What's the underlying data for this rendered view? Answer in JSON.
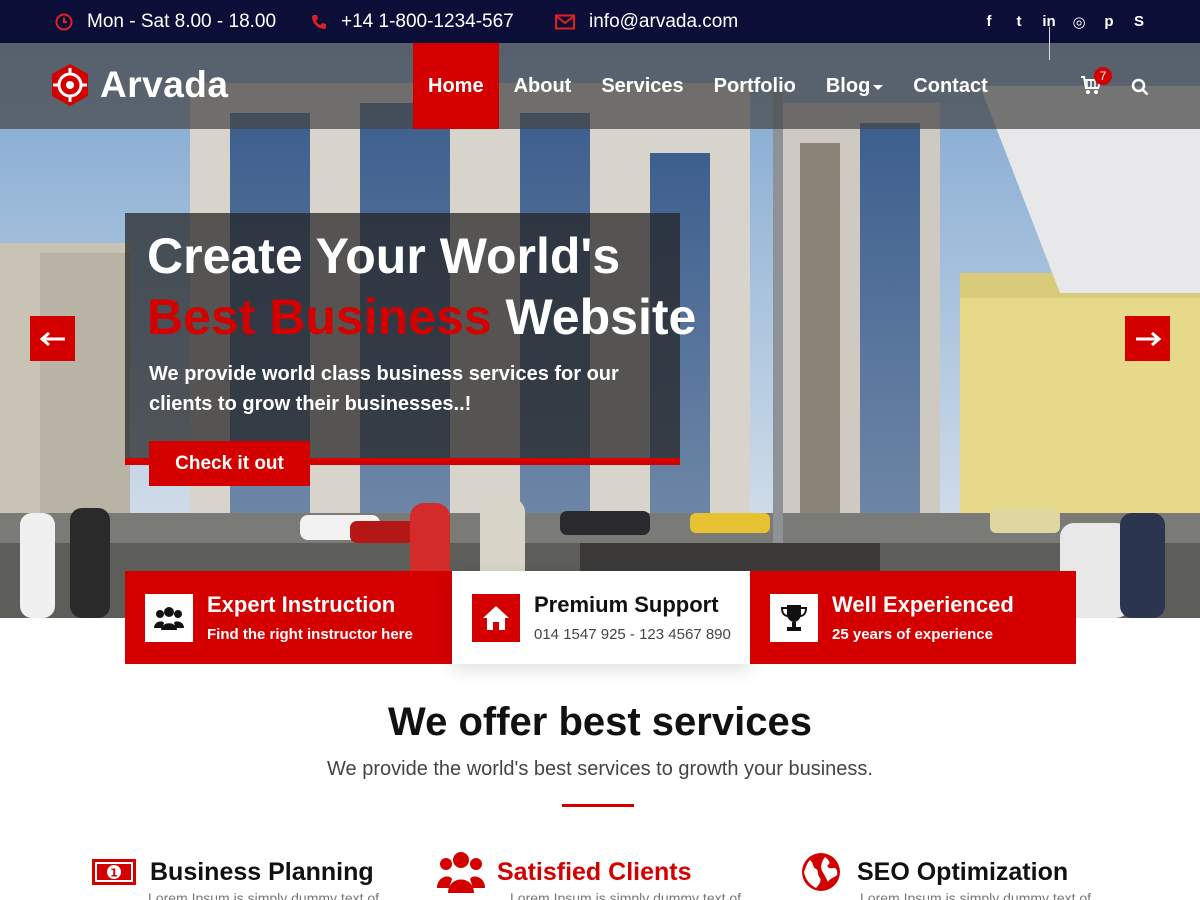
{
  "topbar": {
    "hours": "Mon - Sat 8.00 - 18.00",
    "phone": "+14 1-800-1234-567",
    "email": "info@arvada.com",
    "social_icons": [
      "facebook-icon",
      "twitter-icon",
      "linkedin-icon",
      "instagram-icon",
      "pinterest-icon",
      "skype-icon"
    ],
    "social_glyphs": [
      "f",
      "t",
      "in",
      "◎",
      "p",
      "S"
    ]
  },
  "header": {
    "logo_text": "Arvada",
    "nav": [
      {
        "label": "Home",
        "active": true
      },
      {
        "label": "About"
      },
      {
        "label": "Services"
      },
      {
        "label": "Portfolio"
      },
      {
        "label": "Blog",
        "dropdown": true
      },
      {
        "label": "Contact"
      }
    ],
    "cart_count": "7"
  },
  "hero": {
    "headline_line1": "Create Your World's",
    "headline_line2_red": "Best Business",
    "headline_line2_white": "Website",
    "subtitle": "We provide world class business services for our clients to grow their businesses..!",
    "cta_label": "Check it out"
  },
  "features": [
    {
      "title": "Expert Instruction",
      "subtitle": "Find the right instructor here",
      "icon": "users-icon"
    },
    {
      "title": "Premium Support",
      "subtitle": "014 1547 925 - 123 4567 890",
      "icon": "home-icon"
    },
    {
      "title": "Well Experienced",
      "subtitle": "25 years of experience",
      "icon": "trophy-icon"
    }
  ],
  "services": {
    "title": "We offer best services",
    "subtitle": "We provide the world's best services to growth your business.",
    "items": [
      {
        "title": "Business Planning",
        "icon": "money-icon",
        "desc": "Lorem Ipsum is simply dummy text of"
      },
      {
        "title": "Satisfied Clients",
        "icon": "users-icon",
        "desc": "Lorem Ipsum is simply dummy text of"
      },
      {
        "title": "SEO Optimization",
        "icon": "globe-icon",
        "desc": "Lorem Ipsum is simply dummy text of"
      }
    ]
  },
  "colors": {
    "accent": "#d40000",
    "topbar_bg": "#0b0f38"
  }
}
